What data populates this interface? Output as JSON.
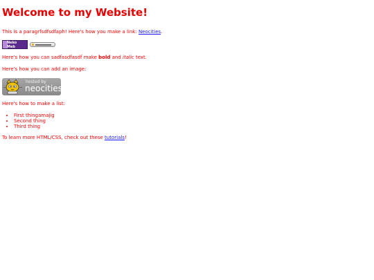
{
  "page": {
    "title": "Welcome to my Website!",
    "intro_text": "This is a paragrfsdfsdfaph! Here's how you make a link: ",
    "intro_link": "Neocities",
    "intro_end": ".",
    "bold_intro": "Here's how you can sadfasdfasdf make ",
    "bold_word": "bold",
    "and_word": " and ",
    "italic_word": "italic",
    "text_end": " text.",
    "image_intro": "Here's how you can add an image:",
    "list_intro": "Here's how to make a list:",
    "list_items": [
      "First thingamajig",
      "Second thing",
      "Third thing"
    ],
    "outro_text": "To learn more HTML/CSS, check out these ",
    "outro_link": "tutorials",
    "outro_end": "!"
  },
  "badges": {
    "neko_text": "Neko\nMeb"
  },
  "hosted_badge": {
    "hosted_by": "hosted by",
    "brand": "neocities"
  },
  "colors": {
    "text": "#ff0000",
    "link": "#1a1aff"
  }
}
